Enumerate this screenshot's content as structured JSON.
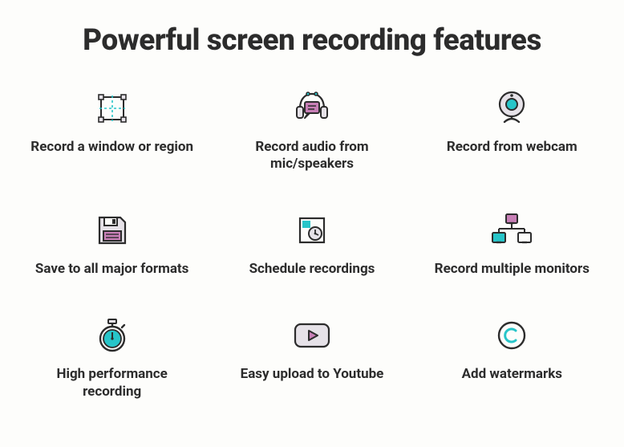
{
  "heading": "Powerful screen recording features",
  "features": [
    {
      "label": "Record a window or region"
    },
    {
      "label": "Record audio from mic/speakers"
    },
    {
      "label": "Record from webcam"
    },
    {
      "label": "Save to all major formats"
    },
    {
      "label": "Schedule recordings"
    },
    {
      "label": "Record multiple monitors"
    },
    {
      "label": "High performance recording"
    },
    {
      "label": "Easy upload to Youtube"
    },
    {
      "label": "Add watermarks"
    }
  ],
  "palette": {
    "outline": "#2c2c2c",
    "teal": "#27c5c9",
    "magenta": "#c77fb6",
    "light": "#e6e2e8"
  }
}
